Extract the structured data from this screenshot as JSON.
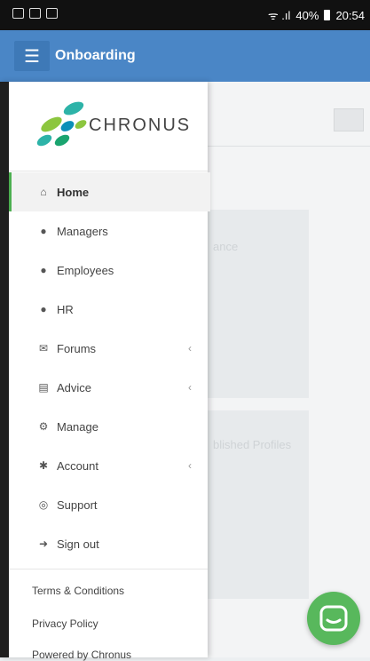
{
  "status": {
    "signal_text": "ᯤ .ıl",
    "battery": "40%",
    "time": "20:54"
  },
  "appbar": {
    "title": "Onboarding",
    "menu_icon": "hamburger-icon"
  },
  "logo": {
    "text": "CHRONUS"
  },
  "nav": [
    {
      "icon": "home-icon",
      "glyph": "⌂",
      "label": "Home",
      "active": true,
      "chevron": ""
    },
    {
      "icon": "user-icon",
      "glyph": "●",
      "label": "Managers",
      "chevron": ""
    },
    {
      "icon": "user-icon",
      "glyph": "●",
      "label": "Employees",
      "chevron": ""
    },
    {
      "icon": "user-icon",
      "glyph": "●",
      "label": "HR",
      "chevron": ""
    },
    {
      "icon": "comments-icon",
      "glyph": "✉",
      "label": "Forums",
      "chevron": "‹"
    },
    {
      "icon": "file-icon",
      "glyph": "▤",
      "label": "Advice",
      "chevron": "‹"
    },
    {
      "icon": "cogs-icon",
      "glyph": "⚙",
      "label": "Manage",
      "chevron": ""
    },
    {
      "icon": "gear-icon",
      "glyph": "✱",
      "label": "Account",
      "chevron": "‹"
    },
    {
      "icon": "lifebuoy-icon",
      "glyph": "◎",
      "label": "Support",
      "chevron": ""
    },
    {
      "icon": "sign-out-icon",
      "glyph": "➜",
      "label": "Sign out",
      "chevron": ""
    }
  ],
  "footer": {
    "terms": "Terms & Conditions",
    "privacy": "Privacy Policy",
    "powered": "Powered by Chronus"
  },
  "background": {
    "text1": "ance",
    "text2": "blished Profiles"
  },
  "colors": {
    "appbar": "#4a86c6",
    "accent": "#4caf50",
    "fab": "#58b85c"
  }
}
